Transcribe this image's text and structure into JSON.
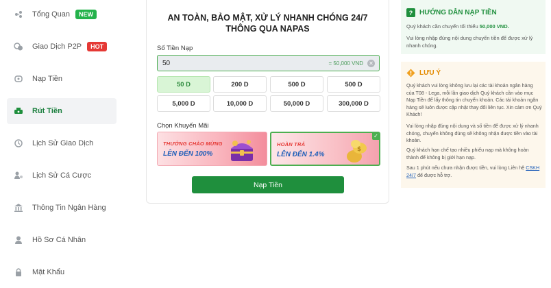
{
  "sidebar": {
    "items": [
      {
        "label": "Tổng Quan",
        "badge": "NEW",
        "icon": "gamepad-icon"
      },
      {
        "label": "Giao Dịch P2P",
        "badge": "HOT",
        "icon": "coins-icon"
      },
      {
        "label": "Nạp Tiền",
        "icon": "deposit-icon"
      },
      {
        "label": "Rút Tiền",
        "icon": "withdraw-icon",
        "active": true
      },
      {
        "label": "Lịch Sử Giao Dịch",
        "icon": "history-icon"
      },
      {
        "label": "Lịch Sử Cá Cược",
        "icon": "bet-history-icon"
      },
      {
        "label": "Thông Tin Ngân Hàng",
        "icon": "bank-icon"
      },
      {
        "label": "Hồ Sơ Cá Nhân",
        "icon": "user-icon"
      },
      {
        "label": "Mật Khẩu",
        "icon": "lock-icon"
      }
    ]
  },
  "main": {
    "title_line1": "AN TOÀN, BẢO MẬT, XỬ LÝ NHANH CHÓNG 24/7",
    "title_line2": "THÔNG QUA NAPAS",
    "amount_label": "Số Tiền Nạp",
    "amount_value": "50",
    "amount_conversion": "= 50,000 VND",
    "quick_amounts": [
      "50 D",
      "200 D",
      "500 D",
      "500 D",
      "5,000 D",
      "10,000 D",
      "50,000 D",
      "300,000 D"
    ],
    "selected_amount_index": 0,
    "promo_label": "Chọn Khuyến Mãi",
    "promos": [
      {
        "title": "THƯỞNG CHÀO MỪNG",
        "subtitle": "LÊN ĐẾN 100%"
      },
      {
        "title": "HOÀN TRẢ",
        "subtitle": "LÊN ĐẾN 1.4%",
        "selected": true
      }
    ],
    "submit_label": "Nạp Tiền"
  },
  "guide": {
    "title": "HƯỚNG DẪN NẠP TIỀN",
    "min_text": "Quý khách cần chuyển tối thiểu",
    "min_amount": "50,000 VND.",
    "note": "Vui lòng nhập đúng nội dung chuyển tiền để được xử lý nhanh chóng."
  },
  "warning": {
    "title": "LƯU Ý",
    "p1": "Quý khách vui lòng không lưu lại các tài khoản ngân hàng của T08 - Lega, mỗi lần giao dịch Quý khách cần vào mục Nạp Tiền để lấy thông tin chuyển khoản. Các tài khoản ngân hàng sẽ luôn được cập nhật thay đổi liên tục. Xin cảm ơn Quý Khách!",
    "p2": "Vui lòng nhập đúng nội dung và số tiền để được xử lý nhanh chóng, chuyển không đúng sẽ không nhận được tiền vào tài khoản.",
    "p3": "Quý khách hạn chế tạo nhiều phiếu nạp mà không hoàn thành để không bị giới hạn nạp.",
    "p4_pre": "Sau 1 phút nếu chưa nhận được tiền, vui lòng Liên hệ",
    "p4_link": "CSKH 24/7",
    "p4_post": "để được hỗ trợ."
  },
  "colors": {
    "accent": "#1f8f3d",
    "warning": "#e38a00",
    "hot": "#e53935",
    "new": "#24b24b"
  }
}
